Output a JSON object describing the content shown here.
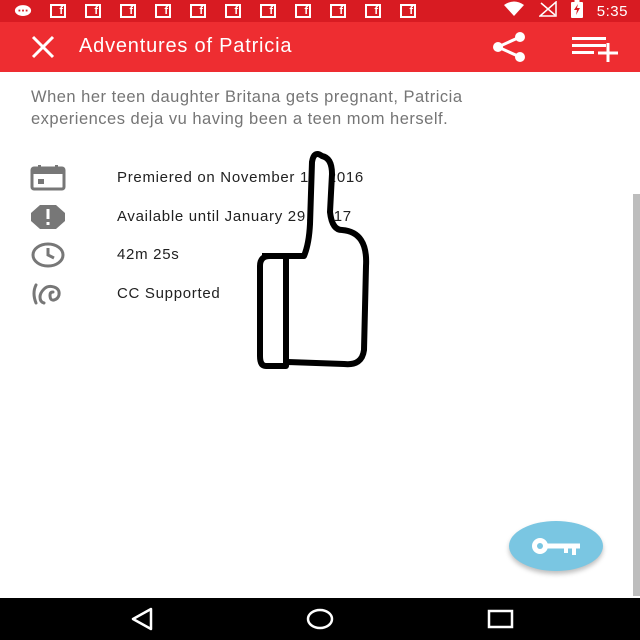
{
  "status_bar": {
    "time": "5:35",
    "left_icons": [
      "messenger-icon",
      "facebook-icon",
      "facebook-icon",
      "facebook-icon",
      "facebook-icon",
      "facebook-icon",
      "facebook-icon",
      "facebook-icon",
      "facebook-icon",
      "facebook-icon",
      "facebook-icon",
      "facebook-icon"
    ],
    "fb_letter": "f",
    "right_icons": [
      "wifi-icon",
      "no-signal-icon",
      "battery-charging-icon"
    ]
  },
  "app_bar": {
    "title": "Adventures of Patricia",
    "close_icon": "close-icon",
    "share_icon": "share-icon",
    "playlist_icon": "playlist-add-icon"
  },
  "description": "When her teen daughter Britana gets pregnant, Patricia experiences deja vu having been a teen mom herself.",
  "details": [
    {
      "icon": "calendar-icon",
      "text": "Premiered on November 15, 2016"
    },
    {
      "icon": "alert-octagon-icon",
      "text": "Available until January 29, 2017"
    },
    {
      "icon": "clock-icon",
      "text": "42m 25s"
    },
    {
      "icon": "hearing-icon",
      "text": "CC Supported"
    }
  ],
  "fab": {
    "icon": "key-icon"
  },
  "nav_bar": {
    "icons": [
      "back-icon",
      "home-icon",
      "recents-icon"
    ]
  },
  "overlay": {
    "icon": "thumbs-up-icon"
  },
  "colors": {
    "status_bar": "#d81b22",
    "app_bar": "#ee2d31",
    "fab": "#7ac6e2",
    "description_text": "#757575",
    "detail_text": "#212121",
    "icon_gray": "#777777"
  }
}
